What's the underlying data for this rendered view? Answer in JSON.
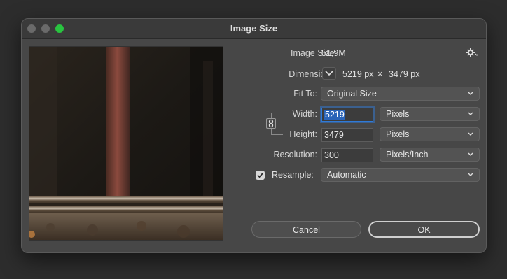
{
  "window": {
    "title": "Image Size"
  },
  "info": {
    "image_size_label": "Image Size:",
    "image_size_value": "51,9M",
    "dimensions_label": "Dimensions:",
    "dim_width": "5219 px",
    "dim_times": "×",
    "dim_height": "3479 px"
  },
  "fit_to": {
    "label": "Fit To:",
    "value": "Original Size"
  },
  "width": {
    "label": "Width:",
    "value": "5219",
    "unit": "Pixels"
  },
  "height": {
    "label": "Height:",
    "value": "3479",
    "unit": "Pixels"
  },
  "resolution": {
    "label": "Resolution:",
    "value": "300",
    "unit": "Pixels/Inch"
  },
  "resample": {
    "label": "Resample:",
    "checked": true,
    "value": "Automatic"
  },
  "buttons": {
    "cancel": "Cancel",
    "ok": "OK"
  },
  "icons": {
    "settings": "gear-icon",
    "dimensions_toggle": "chevron-down-icon",
    "constrain": "chain-link-icon",
    "checkbox": "checkmark-icon"
  },
  "colors": {
    "accent": "#2f7ad8",
    "zoom_button": "#29c440"
  }
}
